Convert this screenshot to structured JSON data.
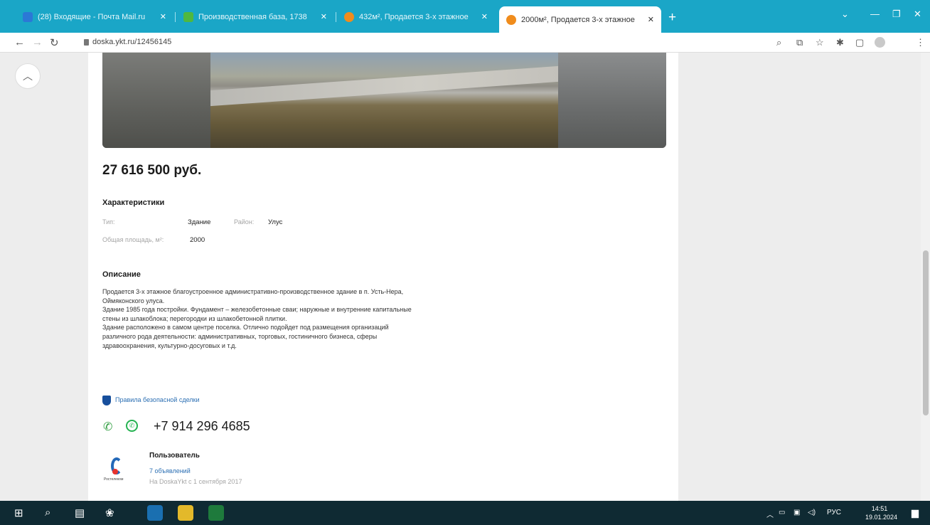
{
  "browser": {
    "tabs": [
      {
        "title": "(28) Входящие - Почта Mail.ru",
        "favicon_color": "#2b78d6"
      },
      {
        "title": "Производственная база, 1738",
        "favicon_color": "#4fb83f"
      },
      {
        "title": "432м², Продается 3-х этажное",
        "favicon_color": "#f08c1c"
      },
      {
        "title": "2000м², Продается 3-х этажное",
        "favicon_color": "#f08c1c",
        "active": true
      }
    ],
    "url": "doska.ykt.ru/12456145",
    "new_tab": "+",
    "win_minimize": "—",
    "win_maximize": "❐",
    "win_close": "✕"
  },
  "listing": {
    "price": "27 616 500 руб.",
    "characteristics_title": "Характеристики",
    "type_label": "Тип:",
    "type_value": "Здание",
    "district_label": "Район:",
    "district_value": "Улус",
    "area_label": "Общая площадь, м²:",
    "area_value": "2000",
    "description_title": "Описание",
    "description_lines": [
      "Продается 3-х этажное благоустроенное административно-производственное здание в п. Усть-Нера,",
      "Оймяконского улуса.",
      "Здание 1985 года постройки. Фундамент – железобетонные сваи; наружные и внутренние капитальные",
      "стены из шлакоблока; перегородки из шлакобетонной плитки.",
      "Здание расположено в самом центре поселка. Отлично подойдет под размещения организаций",
      "различного рода деятельности: административных, торговых, гостиничного бизнеса, сферы",
      "здравоохранения, культурно-досуговых и т.д."
    ],
    "safe_deal_link": "Правила безопасной сделки",
    "phone": "+7 914 296 4685"
  },
  "seller": {
    "name": "Пользователь",
    "ads": "7 объявлений",
    "since": "На DoskaYkt с 1 сентября 2017",
    "logo_caption": "Ростелеком"
  },
  "taskbar": {
    "tray_lang": "РУС",
    "time": "14:51",
    "date": "19.01.2024"
  },
  "colors": {
    "tabbar": "#1aa6c7",
    "taskbar": "#0f2a33",
    "link": "#2c6fb3",
    "whatsapp": "#26b352"
  }
}
